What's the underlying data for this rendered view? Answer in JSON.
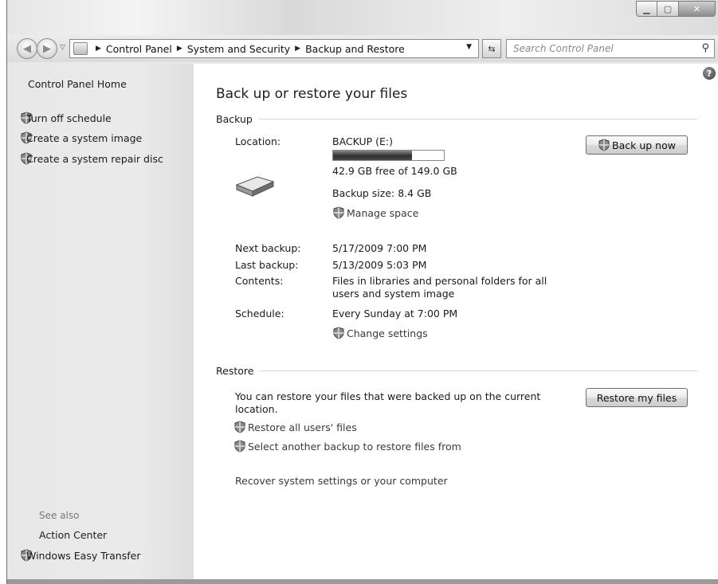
{
  "window": {
    "minimize_icon": "minimize-icon",
    "maximize_icon": "maximize-icon",
    "close_icon": "close-icon"
  },
  "address_bar": {
    "crumbs": [
      "Control Panel",
      "System and Security",
      "Backup and Restore"
    ],
    "search_placeholder": "Search Control Panel"
  },
  "sidebar": {
    "home": "Control Panel Home",
    "tasks": [
      "Turn off schedule",
      "Create a system image",
      "Create a system repair disc"
    ],
    "see_also": "See also",
    "see_also_links": [
      "Action Center",
      "Windows Easy Transfer"
    ]
  },
  "main": {
    "title": "Back up or restore your files",
    "backup": {
      "heading": "Backup",
      "location_label": "Location:",
      "location_value": "BACKUP (E:)",
      "disk_used_fraction": 0.712,
      "free_space": "42.9 GB free of 149.0 GB",
      "backup_size": "Backup size: 8.4 GB",
      "manage_space": "Manage space",
      "next_backup_label": "Next backup:",
      "next_backup_value": "5/17/2009 7:00 PM",
      "last_backup_label": "Last backup:",
      "last_backup_value": "5/13/2009 5:03 PM",
      "contents_label": "Contents:",
      "contents_value": "Files in libraries and personal folders for all users and system image",
      "schedule_label": "Schedule:",
      "schedule_value": "Every Sunday at 7:00 PM",
      "change_settings": "Change settings",
      "back_up_now": "Back up now"
    },
    "restore": {
      "heading": "Restore",
      "description": "You can restore your files that were backed up on the current location.",
      "restore_all_users": "Restore all users' files",
      "select_another": "Select another backup to restore files from",
      "recover_system": "Recover system settings or your computer",
      "restore_my_files": "Restore my files"
    }
  }
}
